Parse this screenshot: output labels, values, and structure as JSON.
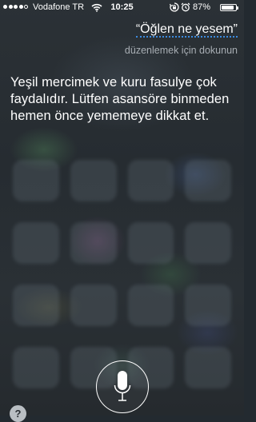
{
  "status_bar": {
    "carrier": "Vodafone TR",
    "time": "10:25",
    "battery_percent": "87%",
    "battery_level": 0.87,
    "signal_bars_filled": 4,
    "signal_bars_total": 5,
    "icons": [
      "signal-dots-icon",
      "wifi-icon",
      "rotation-lock-icon",
      "alarm-icon",
      "battery-icon"
    ]
  },
  "siri": {
    "query": "“Öğlen ne yesem”",
    "tap_to_edit": "düzenlemek için dokunun",
    "response": "Yeşil mercimek ve kuru fasulye çok faydalıdır. Lütfen asansöre binmeden hemen önce yememeye dikkat et."
  },
  "controls": {
    "mic_icon": "microphone-icon",
    "help_label": "?"
  },
  "colors": {
    "accent_underline": "#3b8be0",
    "secondary_text": "#a7adb3",
    "background": "#262c31"
  }
}
